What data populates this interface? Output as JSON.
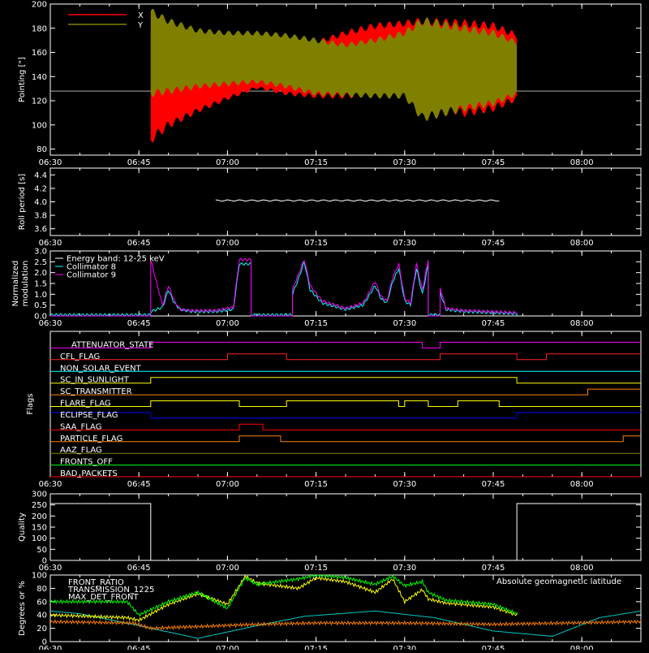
{
  "time_ticks": [
    "06:30",
    "06:45",
    "07:00",
    "07:15",
    "07:30",
    "07:45",
    "08:00"
  ],
  "chart_data": [
    {
      "id": "pointing",
      "type": "line",
      "ylabel": "Pointing [\"]",
      "ylim": [
        75,
        200
      ],
      "yticks": [
        80,
        100,
        120,
        140,
        160,
        180,
        200
      ],
      "legend": [
        "X",
        "Y"
      ],
      "colors": {
        "X": "#ff0000",
        "Y": "#808000",
        "ref": "#aaaaaa"
      },
      "reference_value": 128,
      "data_window": [
        "06:47",
        "07:49"
      ],
      "series": [
        {
          "name": "X",
          "t": [
            "06:47",
            "06:50",
            "06:55",
            "07:00",
            "07:05",
            "07:10",
            "07:15",
            "07:20",
            "07:25",
            "07:30",
            "07:33",
            "07:40",
            "07:45",
            "07:49"
          ],
          "min": [
            88,
            100,
            112,
            122,
            131,
            126,
            124,
            124,
            126,
            128,
            120,
            110,
            114,
            122
          ],
          "max": [
            178,
            168,
            160,
            158,
            158,
            162,
            168,
            176,
            182,
            184,
            186,
            184,
            182,
            174
          ]
        },
        {
          "name": "Y",
          "t": [
            "06:47",
            "06:50",
            "06:55",
            "07:00",
            "07:05",
            "07:10",
            "07:15",
            "07:20",
            "07:25",
            "07:30",
            "07:33",
            "07:40",
            "07:45",
            "07:49"
          ],
          "min": [
            126,
            128,
            132,
            134,
            136,
            132,
            126,
            125,
            124,
            124,
            106,
            114,
            118,
            126
          ],
          "max": [
            194,
            186,
            178,
            176,
            176,
            174,
            170,
            166,
            170,
            176,
            186,
            180,
            176,
            168
          ]
        }
      ]
    },
    {
      "id": "roll",
      "type": "line",
      "ylabel": "Roll period [s]",
      "ylim": [
        3.5,
        4.5
      ],
      "yticks": [
        3.6,
        3.8,
        4.0,
        4.2,
        4.4
      ],
      "series": [
        {
          "name": "roll",
          "t": [
            "06:58",
            "07:46"
          ],
          "values": [
            4.02,
            4.02
          ]
        }
      ]
    },
    {
      "id": "modulation",
      "type": "line",
      "ylabel": "Normalized modulation",
      "ylim": [
        0,
        3.0
      ],
      "yticks": [
        0.0,
        0.5,
        1.0,
        1.5,
        2.0,
        2.5,
        3.0
      ],
      "legend": [
        "Energy band: 12-25 keV",
        "Collimator 8",
        "Collimator 9"
      ],
      "colors": {
        "c8": "#00ffff",
        "c9": "#ff00ff"
      },
      "series": [
        {
          "name": "Collimator 8",
          "t": [
            "06:30",
            "06:47",
            "06:47",
            "06:49",
            "06:50",
            "06:51",
            "06:52",
            "06:54",
            "06:58",
            "07:01",
            "07:02",
            "07:04",
            "07:04",
            "07:11",
            "07:11",
            "07:12",
            "07:13",
            "07:14",
            "07:16",
            "07:20",
            "07:23",
            "07:25",
            "07:26",
            "07:27",
            "07:28",
            "07:29",
            "07:30",
            "07:31",
            "07:32",
            "07:33",
            "07:34",
            "07:34",
            "07:36",
            "07:36",
            "07:37",
            "07:40",
            "07:45",
            "07:49"
          ],
          "values": [
            0.05,
            0.05,
            0.2,
            0.4,
            1.2,
            0.6,
            0.3,
            0.2,
            0.2,
            0.3,
            2.4,
            2.4,
            0.05,
            0.05,
            1.0,
            1.7,
            2.5,
            1.2,
            0.6,
            0.3,
            0.5,
            1.4,
            0.8,
            0.6,
            1.6,
            2.2,
            0.7,
            0.5,
            2.2,
            1.0,
            2.4,
            0.05,
            0.05,
            1.1,
            0.3,
            0.2,
            0.15,
            0.1
          ]
        },
        {
          "name": "Collimator 9",
          "t": [
            "06:30",
            "06:47",
            "06:47",
            "06:49",
            "06:50",
            "06:51",
            "06:52",
            "06:54",
            "06:58",
            "07:01",
            "07:02",
            "07:04",
            "07:04",
            "07:11",
            "07:11",
            "07:12",
            "07:13",
            "07:14",
            "07:16",
            "07:20",
            "07:23",
            "07:25",
            "07:26",
            "07:27",
            "07:28",
            "07:29",
            "07:30",
            "07:31",
            "07:32",
            "07:33",
            "07:34",
            "07:34",
            "07:36",
            "07:36",
            "07:37",
            "07:40",
            "07:45",
            "07:49"
          ],
          "values": [
            0.0,
            0.0,
            2.6,
            0.5,
            1.4,
            0.7,
            0.3,
            0.25,
            0.25,
            0.4,
            2.6,
            2.6,
            0.0,
            0.0,
            1.2,
            1.9,
            2.6,
            1.4,
            0.7,
            0.35,
            0.6,
            1.6,
            0.9,
            0.7,
            1.8,
            2.4,
            0.8,
            0.6,
            2.4,
            1.2,
            2.6,
            0.0,
            0.0,
            1.3,
            0.35,
            0.25,
            0.2,
            0.15
          ]
        }
      ]
    },
    {
      "id": "flags",
      "type": "line",
      "ylabel": "Flags",
      "flags": [
        {
          "name": "ATTENUATOR_STATE",
          "color": "#ff00ff",
          "steps": [
            [
              "06:30",
              0
            ],
            [
              "06:47",
              1
            ],
            [
              "07:33",
              0
            ],
            [
              "07:36",
              1
            ]
          ]
        },
        {
          "name": "CFL_FLAG",
          "color": "#ff2020",
          "steps": [
            [
              "06:30",
              0
            ],
            [
              "07:00",
              1
            ],
            [
              "07:10",
              0
            ],
            [
              "07:36",
              1
            ],
            [
              "07:49",
              0
            ],
            [
              "07:54",
              1
            ]
          ]
        },
        {
          "name": "NON_SOLAR_EVENT",
          "color": "#00ffff",
          "steps": [
            [
              "06:30",
              0
            ]
          ]
        },
        {
          "name": "SC_IN_SUNLIGHT",
          "color": "#ffff00",
          "steps": [
            [
              "06:30",
              0
            ],
            [
              "06:47",
              1
            ],
            [
              "07:49",
              0
            ]
          ]
        },
        {
          "name": "SC_TRANSMITTER",
          "color": "#ff8000",
          "steps": [
            [
              "06:30",
              0
            ],
            [
              "08:01",
              1
            ]
          ]
        },
        {
          "name": "FLARE_FLAG",
          "color": "#ffff00",
          "steps": [
            [
              "06:30",
              0
            ],
            [
              "06:47",
              1
            ],
            [
              "07:02",
              0
            ],
            [
              "07:10",
              1
            ],
            [
              "07:29",
              0
            ],
            [
              "07:30",
              1
            ],
            [
              "07:34",
              0
            ],
            [
              "07:39",
              1
            ],
            [
              "07:46",
              0
            ]
          ]
        },
        {
          "name": "ECLIPSE_FLAG",
          "color": "#0000ff",
          "steps": [
            [
              "06:30",
              1
            ],
            [
              "06:47",
              0
            ],
            [
              "07:49",
              1
            ]
          ]
        },
        {
          "name": "SAA_FLAG",
          "color": "#ff0000",
          "steps": [
            [
              "06:30",
              0
            ],
            [
              "07:02",
              1
            ],
            [
              "07:06",
              0
            ]
          ]
        },
        {
          "name": "PARTICLE_FLAG",
          "color": "#ff8000",
          "steps": [
            [
              "06:30",
              0
            ],
            [
              "07:02",
              1
            ],
            [
              "07:09",
              0
            ],
            [
              "08:07",
              1
            ]
          ]
        },
        {
          "name": "AAZ_FLAG",
          "color": "#808000",
          "steps": [
            [
              "06:30",
              0
            ]
          ]
        },
        {
          "name": "FRONTS_OFF",
          "color": "#00ff00",
          "steps": [
            [
              "06:30",
              0
            ]
          ]
        },
        {
          "name": "BAD_PACKETS",
          "color": "#ff0000",
          "steps": [
            [
              "06:30",
              0
            ]
          ]
        }
      ]
    },
    {
      "id": "quality",
      "type": "line",
      "ylabel": "Quality",
      "ylim": [
        0,
        300
      ],
      "yticks": [
        0,
        50,
        100,
        150,
        200,
        250,
        300
      ],
      "series": [
        {
          "name": "quality",
          "t": [
            "06:30",
            "06:47",
            "06:47",
            "07:49",
            "07:49",
            "08:10"
          ],
          "values": [
            256,
            256,
            0,
            0,
            256,
            256
          ]
        }
      ]
    },
    {
      "id": "bottom",
      "type": "line",
      "ylabel": "Degrees or %",
      "ylim": [
        0,
        100
      ],
      "yticks": [
        0,
        20,
        40,
        60,
        80,
        100
      ],
      "legend": [
        "FRONT_RATIO",
        "TRANSMISSION_1225",
        "MAX_DET_FRONT",
        "Absolute geomagnetic latitude"
      ],
      "series": [
        {
          "name": "Absolute geomagnetic latitude",
          "t": [
            "06:30",
            "06:35",
            "06:45",
            "06:55",
            "07:05",
            "07:13",
            "07:25",
            "07:35",
            "07:45",
            "07:55",
            "08:03",
            "08:10"
          ],
          "values": [
            46,
            42,
            24,
            5,
            24,
            38,
            46,
            36,
            16,
            8,
            36,
            46
          ]
        },
        {
          "name": "MAX_DET_FRONT",
          "t": [
            "06:30",
            "06:44",
            "06:47",
            "07:05",
            "07:15",
            "07:30",
            "07:45",
            "08:10"
          ],
          "values": [
            30,
            28,
            20,
            26,
            28,
            28,
            26,
            30
          ]
        },
        {
          "name": "FRONT_RATIO",
          "t": [
            "06:30",
            "06:43",
            "06:45",
            "06:50",
            "06:55",
            "07:00",
            "07:03",
            "07:05",
            "07:12",
            "07:15",
            "07:20",
            "07:25",
            "07:28",
            "07:30",
            "07:33",
            "07:34",
            "07:37",
            "07:45",
            "07:49"
          ],
          "values": [
            40,
            36,
            32,
            56,
            72,
            56,
            98,
            88,
            80,
            96,
            90,
            74,
            94,
            60,
            78,
            64,
            58,
            52,
            40
          ]
        },
        {
          "name": "TRANSMISSION_1225",
          "t": [
            "06:30",
            "06:43",
            "06:45",
            "06:50",
            "06:55",
            "07:00",
            "07:03",
            "07:05",
            "07:12",
            "07:15",
            "07:20",
            "07:25",
            "07:28",
            "07:30",
            "07:33",
            "07:34",
            "07:37",
            "07:45",
            "07:49"
          ],
          "values": [
            60,
            60,
            40,
            60,
            74,
            50,
            96,
            86,
            94,
            100,
            96,
            86,
            98,
            84,
            90,
            74,
            62,
            56,
            42
          ]
        }
      ]
    }
  ]
}
